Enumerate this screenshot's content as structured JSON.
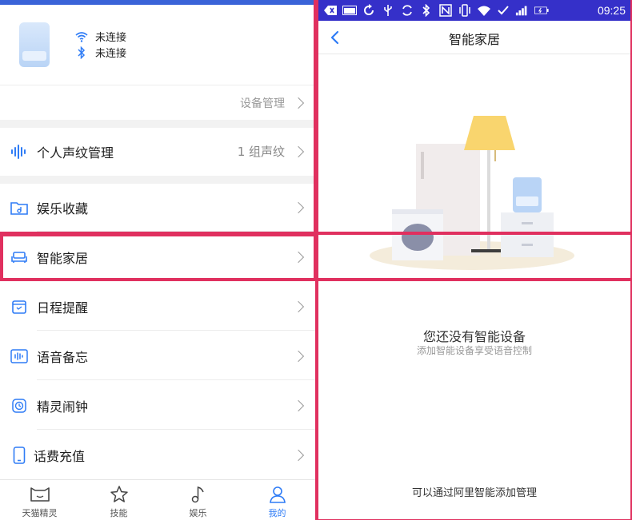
{
  "left": {
    "device": {
      "wifi_status": "未连接",
      "bluetooth_status": "未连接"
    },
    "device_manage_label": "设备管理",
    "menu": [
      {
        "label": "个人声纹管理",
        "value": "1 组声纹",
        "icon": "voiceprint-icon"
      },
      {
        "label": "娱乐收藏",
        "value": "",
        "icon": "folder-music-icon"
      },
      {
        "label": "智能家居",
        "value": "",
        "icon": "sofa-icon"
      },
      {
        "label": "日程提醒",
        "value": "",
        "icon": "calendar-icon"
      },
      {
        "label": "语音备忘",
        "value": "",
        "icon": "voice-memo-icon"
      },
      {
        "label": "精灵闹钟",
        "value": "",
        "icon": "alarm-icon"
      },
      {
        "label": "话费充值",
        "value": "",
        "icon": "phone-icon"
      }
    ],
    "tabs": [
      {
        "label": "天猫精灵",
        "icon": "tmall-genie-icon"
      },
      {
        "label": "技能",
        "icon": "star-icon"
      },
      {
        "label": "娱乐",
        "icon": "music-note-icon"
      },
      {
        "label": "我的",
        "icon": "person-icon"
      }
    ],
    "active_tab": "我的"
  },
  "right": {
    "status_time": "09:25",
    "title": "智能家居",
    "empty_title": "您还没有智能设备",
    "empty_subtitle": "添加智能设备享受语音控制",
    "bottom_hint": "可以通过阿里智能添加管理"
  },
  "colors": {
    "accent": "#2f7cf6",
    "highlight": "#e0305f",
    "statusbar": "#3530c9"
  }
}
